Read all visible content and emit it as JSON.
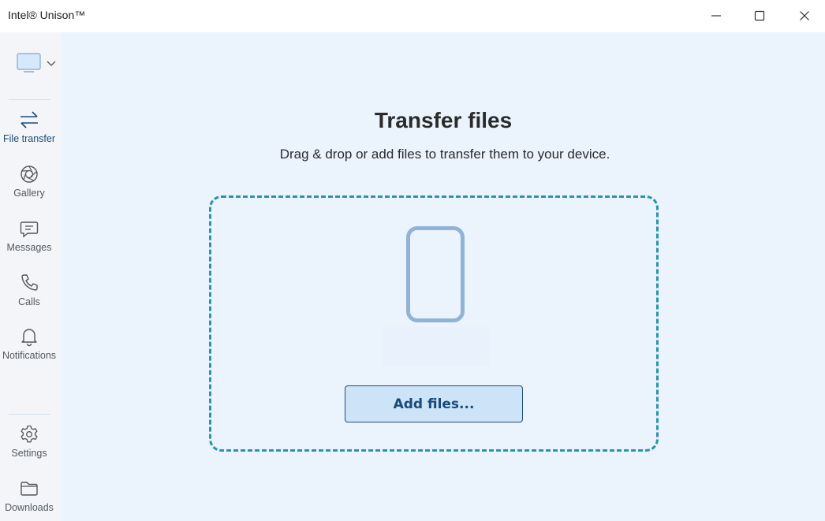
{
  "window": {
    "title": "Intel® Unison™",
    "controls": {
      "minimize": "minimize",
      "maximize": "maximize",
      "close": "close"
    }
  },
  "sidebar": {
    "device_selector": {
      "icon": "monitor-icon",
      "chevron": "chevron-down-icon"
    },
    "items": [
      {
        "id": "file-transfer",
        "label": "File transfer",
        "icon": "transfer-arrows-icon",
        "active": true
      },
      {
        "id": "gallery",
        "label": "Gallery",
        "icon": "aperture-icon",
        "active": false
      },
      {
        "id": "messages",
        "label": "Messages",
        "icon": "chat-icon",
        "active": false
      },
      {
        "id": "calls",
        "label": "Calls",
        "icon": "phone-icon",
        "active": false
      },
      {
        "id": "notifications",
        "label": "Notifications",
        "icon": "bell-icon",
        "active": false
      }
    ],
    "bottom_items": [
      {
        "id": "settings",
        "label": "Settings",
        "icon": "gear-icon"
      },
      {
        "id": "downloads",
        "label": "Downloads",
        "icon": "folder-icon"
      }
    ]
  },
  "main": {
    "title": "Transfer files",
    "subtitle": "Drag & drop or add files to transfer them to your device.",
    "dropzone": {
      "device_icon": "phone-device-icon",
      "device_name": "",
      "add_button_label": "Add files..."
    }
  },
  "colors": {
    "accent": "#2a93ad",
    "button_bg": "#cce3f8",
    "button_border": "#1e4f7a",
    "main_bg": "#ebf3fd",
    "sidebar_bg": "#f3f5f8"
  }
}
